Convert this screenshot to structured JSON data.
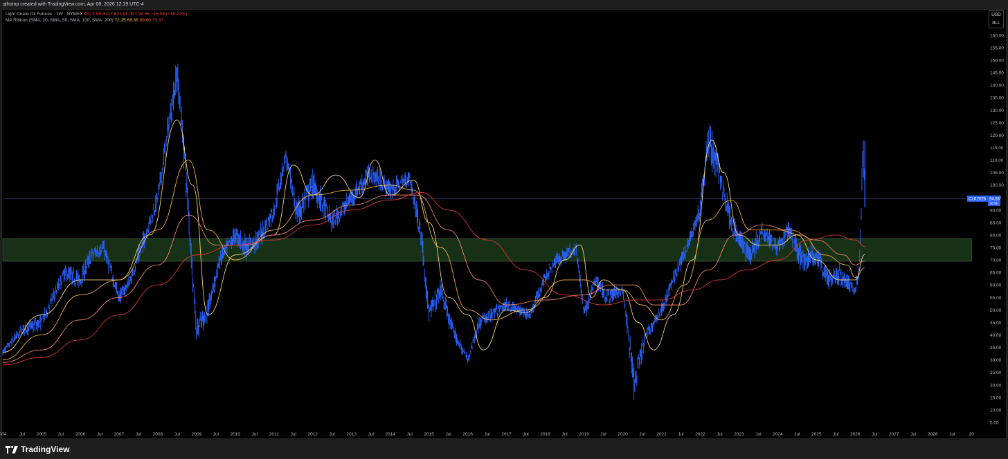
{
  "header": {
    "caption": "qthomp created with TradingView.com, Apr 08, 2026 12:19 UTC-4"
  },
  "legend": {
    "symbol": "Light Crude Oil Futures · 1W · NYMEX",
    "ohlc": "O112.96 H117.63 L91.05 C94.56 −16.98 (−15.22%)",
    "indicator_label": "MA Ribbon (SMA, 20, SMA, 50, SMA, 100, SMA, 200)",
    "ma_values": [
      "72.25",
      "66.88",
      "69.60",
      "75.37"
    ]
  },
  "units": {
    "currency": "USD",
    "unit": "BLL"
  },
  "price_tag": {
    "symbol": "CLK2026",
    "price": "94.56",
    "countdown": "2d 5h"
  },
  "branding": {
    "name": "TradingView"
  },
  "colors": {
    "background": "#000000",
    "candles": "#2962ff",
    "zone_fill": "#1b3a1b",
    "ma20": "#ffe082",
    "ma50": "#ffb74d",
    "ma100": "#ff8a65",
    "ma200": "#e53935",
    "price_line": "#2a3a70"
  },
  "chart_data": {
    "type": "line",
    "title": "Light Crude Oil Futures · 1W · NYMEX",
    "y_axis": {
      "ylim": [
        2.5,
        163
      ],
      "ticks": [
        "5.00",
        "10.00",
        "15.00",
        "20.00",
        "25.00",
        "30.00",
        "35.00",
        "40.00",
        "45.00",
        "50.00",
        "55.00",
        "60.00",
        "65.00",
        "70.00",
        "75.00",
        "80.00",
        "85.00",
        "90.00",
        "95.00",
        "100.00",
        "105.00",
        "110.00",
        "115.00",
        "120.00",
        "125.00",
        "130.00",
        "135.00",
        "140.00",
        "145.00",
        "150.00",
        "155.00",
        "160.00"
      ]
    },
    "x_axis": {
      "xlim": [
        2004.0,
        2029.3
      ],
      "ticks": [
        {
          "x": 2004.0,
          "label": "004"
        },
        {
          "x": 2004.5,
          "label": "Jul"
        },
        {
          "x": 2005.0,
          "label": "2005"
        },
        {
          "x": 2005.5,
          "label": "Jul"
        },
        {
          "x": 2006.0,
          "label": "2006"
        },
        {
          "x": 2006.5,
          "label": "Jul"
        },
        {
          "x": 2007.0,
          "label": "2007"
        },
        {
          "x": 2007.5,
          "label": "Jul"
        },
        {
          "x": 2008.0,
          "label": "2008"
        },
        {
          "x": 2008.5,
          "label": "Jul"
        },
        {
          "x": 2009.0,
          "label": "2009"
        },
        {
          "x": 2009.5,
          "label": "Jul"
        },
        {
          "x": 2010.0,
          "label": "2010"
        },
        {
          "x": 2010.5,
          "label": "Jul"
        },
        {
          "x": 2011.0,
          "label": "2011"
        },
        {
          "x": 2011.5,
          "label": "Jul"
        },
        {
          "x": 2012.0,
          "label": "2012"
        },
        {
          "x": 2012.5,
          "label": "Jul"
        },
        {
          "x": 2013.0,
          "label": "2013"
        },
        {
          "x": 2013.5,
          "label": "Jul"
        },
        {
          "x": 2014.0,
          "label": "2014"
        },
        {
          "x": 2014.5,
          "label": "Jul"
        },
        {
          "x": 2015.0,
          "label": "2015"
        },
        {
          "x": 2015.5,
          "label": "Jul"
        },
        {
          "x": 2016.0,
          "label": "2016"
        },
        {
          "x": 2016.5,
          "label": "Jul"
        },
        {
          "x": 2017.0,
          "label": "2017"
        },
        {
          "x": 2017.5,
          "label": "Jul"
        },
        {
          "x": 2018.0,
          "label": "2018"
        },
        {
          "x": 2018.5,
          "label": "Jul"
        },
        {
          "x": 2019.0,
          "label": "2019"
        },
        {
          "x": 2019.5,
          "label": "Jul"
        },
        {
          "x": 2020.0,
          "label": "2020"
        },
        {
          "x": 2020.5,
          "label": "Jul"
        },
        {
          "x": 2021.0,
          "label": "2021"
        },
        {
          "x": 2021.5,
          "label": "Jul"
        },
        {
          "x": 2022.0,
          "label": "2022"
        },
        {
          "x": 2022.5,
          "label": "Jul"
        },
        {
          "x": 2023.0,
          "label": "2023"
        },
        {
          "x": 2023.5,
          "label": "Jul"
        },
        {
          "x": 2024.0,
          "label": "2024"
        },
        {
          "x": 2024.5,
          "label": "Jul"
        },
        {
          "x": 2025.0,
          "label": "2025"
        },
        {
          "x": 2025.5,
          "label": "Jul"
        },
        {
          "x": 2026.0,
          "label": "2026"
        },
        {
          "x": 2026.5,
          "label": "Jul"
        },
        {
          "x": 2027.0,
          "label": "2027"
        },
        {
          "x": 2027.5,
          "label": "Jul"
        },
        {
          "x": 2028.0,
          "label": "2028"
        },
        {
          "x": 2028.5,
          "label": "Jul"
        },
        {
          "x": 2029.0,
          "label": "20"
        }
      ]
    },
    "price_series": {
      "x": [
        2004.0,
        2004.5,
        2005.0,
        2005.3,
        2005.6,
        2006.0,
        2006.3,
        2006.6,
        2007.0,
        2007.3,
        2007.6,
        2008.0,
        2008.3,
        2008.5,
        2008.7,
        2009.0,
        2009.3,
        2009.6,
        2010.0,
        2010.3,
        2010.6,
        2011.0,
        2011.3,
        2011.6,
        2012.0,
        2012.5,
        2013.0,
        2013.5,
        2014.0,
        2014.5,
        2014.8,
        2015.0,
        2015.3,
        2015.6,
        2016.0,
        2016.3,
        2016.6,
        2017.0,
        2017.3,
        2017.6,
        2018.0,
        2018.3,
        2018.8,
        2019.0,
        2019.3,
        2019.6,
        2020.0,
        2020.3,
        2020.6,
        2021.0,
        2021.3,
        2021.6,
        2022.0,
        2022.2,
        2022.5,
        2022.8,
        2023.0,
        2023.3,
        2023.6,
        2024.0,
        2024.3,
        2024.6,
        2025.0,
        2025.3,
        2025.6,
        2026.0,
        2026.1,
        2026.2,
        2026.25
      ],
      "y": [
        33,
        42,
        45,
        55,
        65,
        62,
        72,
        75,
        55,
        62,
        76,
        95,
        125,
        145,
        110,
        42,
        50,
        70,
        80,
        75,
        78,
        90,
        112,
        88,
        100,
        85,
        95,
        105,
        98,
        103,
        80,
        48,
        58,
        42,
        30,
        45,
        48,
        52,
        50,
        48,
        63,
        70,
        75,
        48,
        62,
        55,
        58,
        20,
        40,
        50,
        62,
        73,
        90,
        118,
        105,
        85,
        78,
        72,
        82,
        75,
        82,
        70,
        72,
        62,
        64,
        58,
        65,
        112,
        94.56
      ],
      "high": [
        35,
        46,
        50,
        60,
        70,
        68,
        78,
        80,
        60,
        66,
        82,
        100,
        132,
        147,
        118,
        48,
        58,
        76,
        84,
        82,
        84,
        96,
        115,
        94,
        110,
        92,
        100,
        112,
        104,
        107,
        88,
        56,
        63,
        48,
        32,
        50,
        52,
        56,
        54,
        52,
        66,
        74,
        77,
        54,
        66,
        60,
        62,
        28,
        44,
        54,
        66,
        77,
        96,
        130,
        118,
        92,
        82,
        78,
        86,
        80,
        88,
        78,
        78,
        68,
        70,
        62,
        70,
        120,
        117.63
      ],
      "low": [
        30,
        38,
        40,
        50,
        60,
        56,
        66,
        70,
        50,
        58,
        70,
        88,
        112,
        128,
        95,
        34,
        45,
        64,
        72,
        68,
        70,
        82,
        102,
        76,
        92,
        78,
        88,
        98,
        92,
        96,
        70,
        42,
        50,
        38,
        26,
        40,
        44,
        48,
        46,
        44,
        58,
        64,
        68,
        44,
        56,
        50,
        55,
        5,
        36,
        46,
        56,
        68,
        82,
        104,
        96,
        78,
        68,
        64,
        74,
        70,
        76,
        62,
        62,
        56,
        58,
        55,
        58,
        90,
        91.05
      ]
    },
    "series": [
      {
        "name": "MA20",
        "color": "#ffe082",
        "x": [
          2004.0,
          2005.0,
          2006.0,
          2007.0,
          2007.8,
          2008.5,
          2008.9,
          2009.3,
          2010.0,
          2011.0,
          2011.5,
          2012.0,
          2012.6,
          2013.2,
          2013.6,
          2014.0,
          2014.6,
          2015.0,
          2015.5,
          2016.0,
          2016.4,
          2017.0,
          2017.5,
          2018.0,
          2018.5,
          2018.9,
          2019.2,
          2019.5,
          2020.0,
          2020.4,
          2020.8,
          2021.3,
          2021.8,
          2022.3,
          2022.6,
          2023.0,
          2023.5,
          2024.0,
          2024.5,
          2025.0,
          2025.6,
          2026.0,
          2026.25
        ],
        "y": [
          33,
          48,
          62,
          62,
          80,
          126,
          100,
          48,
          72,
          80,
          108,
          96,
          104,
          95,
          110,
          96,
          102,
          85,
          55,
          48,
          34,
          50,
          49,
          55,
          70,
          76,
          55,
          62,
          58,
          45,
          34,
          48,
          70,
          118,
          105,
          80,
          76,
          76,
          80,
          70,
          62,
          62,
          72.25
        ]
      },
      {
        "name": "MA50",
        "color": "#ffb74d",
        "x": [
          2004.0,
          2005.0,
          2006.0,
          2007.0,
          2008.0,
          2008.8,
          2009.3,
          2010.0,
          2011.0,
          2012.0,
          2013.0,
          2014.0,
          2014.6,
          2015.3,
          2016.0,
          2016.6,
          2017.5,
          2018.5,
          2019.0,
          2019.6,
          2020.0,
          2020.5,
          2021.0,
          2021.6,
          2022.2,
          2022.8,
          2023.3,
          2024.0,
          2024.6,
          2025.2,
          2025.8,
          2026.0,
          2026.25
        ],
        "y": [
          30,
          40,
          56,
          62,
          82,
          110,
          82,
          70,
          82,
          96,
          98,
          100,
          98,
          75,
          50,
          46,
          50,
          62,
          62,
          58,
          58,
          52,
          46,
          60,
          86,
          94,
          82,
          82,
          80,
          72,
          68,
          63,
          66.88
        ]
      },
      {
        "name": "MA100",
        "color": "#ff8a65",
        "x": [
          2004.0,
          2005.0,
          2006.0,
          2007.0,
          2008.0,
          2008.8,
          2009.5,
          2010.3,
          2011.0,
          2012.0,
          2013.0,
          2014.0,
          2014.7,
          2015.5,
          2016.3,
          2017.0,
          2018.0,
          2019.0,
          2019.7,
          2020.3,
          2020.8,
          2021.5,
          2022.2,
          2022.9,
          2023.6,
          2024.3,
          2025.0,
          2025.7,
          2026.0,
          2026.25
        ],
        "y": [
          29,
          34,
          46,
          55,
          68,
          88,
          76,
          76,
          80,
          86,
          92,
          96,
          96,
          82,
          62,
          52,
          54,
          56,
          60,
          60,
          52,
          52,
          66,
          80,
          84,
          82,
          78,
          72,
          68,
          69.6
        ]
      },
      {
        "name": "MA200",
        "color": "#e53935",
        "x": [
          2004.0,
          2005.0,
          2006.0,
          2007.0,
          2008.0,
          2009.0,
          2010.0,
          2011.0,
          2012.0,
          2013.0,
          2014.0,
          2014.8,
          2015.5,
          2016.5,
          2017.5,
          2018.5,
          2019.5,
          2020.3,
          2021.0,
          2021.8,
          2022.5,
          2023.2,
          2024.0,
          2024.8,
          2025.5,
          2026.0,
          2026.25
        ],
        "y": [
          28,
          31,
          38,
          48,
          60,
          72,
          76,
          78,
          84,
          90,
          94,
          97,
          90,
          78,
          66,
          56,
          52,
          54,
          54,
          58,
          62,
          66,
          70,
          78,
          80,
          78,
          75.37
        ]
      }
    ],
    "zone": {
      "y_low": 69.5,
      "y_high": 78.5,
      "x_start": 2004.0,
      "x_end": 2029.0
    },
    "last_price": 94.56
  }
}
